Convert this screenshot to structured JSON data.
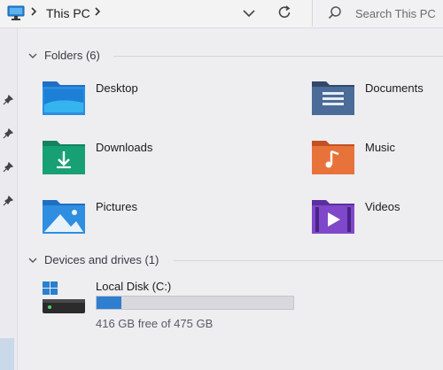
{
  "address_bar": {
    "location_icon": "this-pc-icon",
    "breadcrumb": "This PC",
    "separator_icon": "chevron-right-icon",
    "history_icon": "chevron-down-icon",
    "refresh_icon": "refresh-icon"
  },
  "search": {
    "placeholder": "Search This PC",
    "icon": "search-icon"
  },
  "nav": {
    "pin_icon": "pin-icon",
    "pins": 4
  },
  "folders_section": {
    "label": "Folders (6)",
    "items": [
      {
        "label": "Desktop",
        "icon": "desktop-folder-icon"
      },
      {
        "label": "Documents",
        "icon": "documents-folder-icon"
      },
      {
        "label": "Downloads",
        "icon": "downloads-folder-icon"
      },
      {
        "label": "Music",
        "icon": "music-folder-icon"
      },
      {
        "label": "Pictures",
        "icon": "pictures-folder-icon"
      },
      {
        "label": "Videos",
        "icon": "videos-folder-icon"
      }
    ]
  },
  "drives_section": {
    "label": "Devices and drives (1)",
    "drives": [
      {
        "name": "Local Disk (C:)",
        "icon": "local-disk-icon",
        "free_text": "416 GB free of 475 GB",
        "used_fraction": 0.124,
        "bar_color": "#2f7fd0"
      }
    ]
  },
  "colors": {
    "background": "#eeedf0",
    "accent": "#2f7fd0"
  }
}
